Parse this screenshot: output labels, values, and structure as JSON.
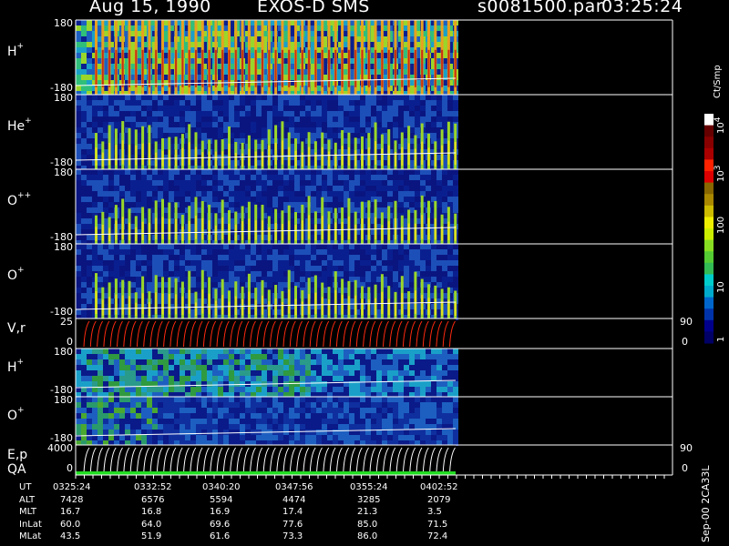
{
  "header": {
    "date": "Aug 15, 1990",
    "mission": "EXOS-D SMS",
    "file": "s0081500.par",
    "time": "03:25:24"
  },
  "panels": [
    {
      "name": "H",
      "sup": "+",
      "top": "180",
      "bottom": "-180",
      "kind": "spec_hot"
    },
    {
      "name": "He",
      "sup": "+",
      "top": "180",
      "bottom": "-180",
      "kind": "spec_warm"
    },
    {
      "name": "O",
      "sup": "++",
      "top": "180",
      "bottom": "-180",
      "kind": "spec_warm"
    },
    {
      "name": "O",
      "sup": "+",
      "top": "180",
      "bottom": "-180",
      "kind": "spec_warm"
    },
    {
      "name": "V,r",
      "sup": "",
      "top": "25",
      "bottom": "0",
      "right_top": "90",
      "right_bottom": "0",
      "kind": "lines_red"
    },
    {
      "name": "H",
      "sup": "+",
      "top": "180",
      "bottom": "-180",
      "kind": "spec_cool"
    },
    {
      "name": "O",
      "sup": "+",
      "top": "180",
      "bottom": "-180",
      "kind": "spec_cool2"
    },
    {
      "name": "E,p",
      "sup": "",
      "name2": "QA",
      "top": "4000",
      "bottom": "0",
      "right_top": "90",
      "right_bottom": "0",
      "kind": "lines_white"
    }
  ],
  "colorbar": {
    "unit": "Ct/Smp",
    "ticks": [
      "1",
      "10",
      "100",
      "10",
      "10"
    ],
    "tick_sups": [
      "",
      "",
      "",
      "3",
      "4"
    ],
    "colors": [
      "#000066",
      "#00008b",
      "#0033aa",
      "#0066cc",
      "#00aacc",
      "#00cccc",
      "#33bb55",
      "#55cc33",
      "#88dd22",
      "#ccee00",
      "#eeee00",
      "#ccbb00",
      "#aa8800",
      "#886600",
      "#dd0000",
      "#ff2200",
      "#aa0000",
      "#880000",
      "#660000",
      "#ffffff"
    ]
  },
  "footer": {
    "rows": [
      {
        "label": "UT",
        "values": [
          "0325:24",
          "0332:52",
          "0340:20",
          "0347:56",
          "0355:24",
          "0402:52"
        ]
      },
      {
        "label": "ALT",
        "values": [
          "7428",
          "6576",
          "5594",
          "4474",
          "3285",
          "2079"
        ]
      },
      {
        "label": "MLT",
        "values": [
          "16.7",
          "16.8",
          "16.9",
          "17.4",
          "21.3",
          "3.5"
        ]
      },
      {
        "label": "InLat",
        "values": [
          "60.0",
          "64.0",
          "69.6",
          "77.6",
          "85.0",
          "71.5"
        ]
      },
      {
        "label": "MLat",
        "values": [
          "43.5",
          "51.9",
          "61.6",
          "73.3",
          "86.0",
          "72.4"
        ]
      }
    ],
    "stamp": "Sep-00 2CA33L"
  }
}
